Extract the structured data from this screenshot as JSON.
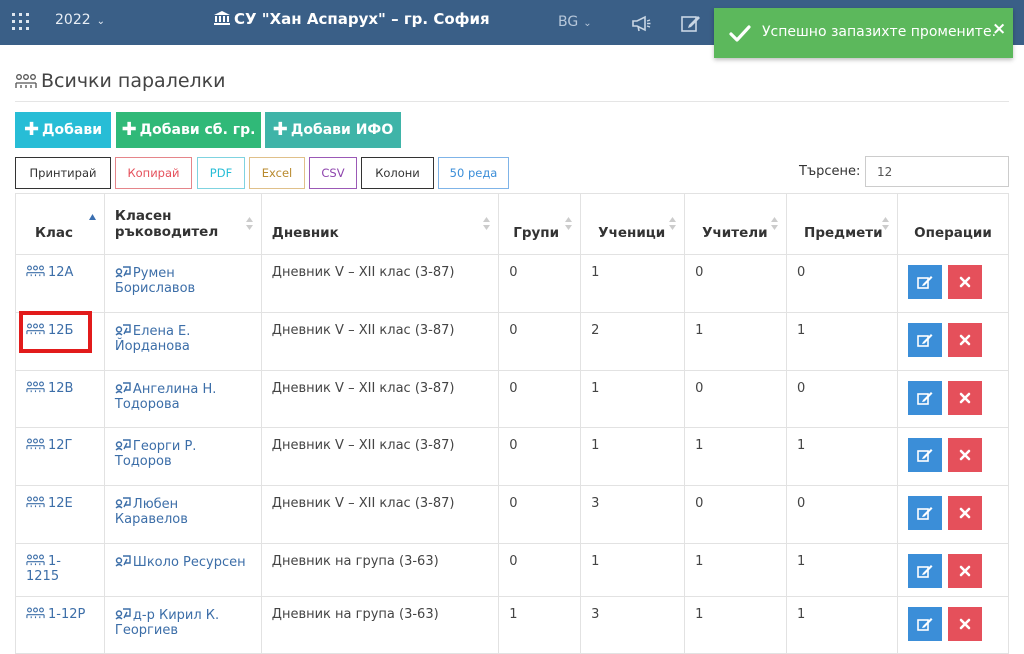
{
  "topbar": {
    "year": "2022",
    "school": "СУ \"Хан Аспарух\" – гр. София",
    "lang": "BG"
  },
  "toast": {
    "message": "Успешно запазихте промените.",
    "close": "×"
  },
  "page": {
    "title": "Всички паралелки"
  },
  "actions": {
    "add": "Добави",
    "add_group": "Добави сб. гр.",
    "add_ifo": "Добави ИФО"
  },
  "export": {
    "print": "Принтирай",
    "copy": "Копирай",
    "pdf": "PDF",
    "excel": "Excel",
    "csv": "CSV",
    "columns": "Колони",
    "rows": "50 реда"
  },
  "search": {
    "label": "Търсене:",
    "value": "12"
  },
  "table": {
    "headers": {
      "klas": "Клас",
      "teacher_line1": "Класен",
      "teacher_line2": "ръководител",
      "diary": "Дневник",
      "groups": "Групи",
      "students": "Ученици",
      "teachers": "Учители",
      "subjects": "Предмети",
      "ops": "Операции"
    },
    "rows": [
      {
        "klas": "12А",
        "t1": "Румен",
        "t2": "Бориславов",
        "diary": "Дневник V – XII клас (3-87)",
        "groups": "0",
        "students": "1",
        "teachers": "0",
        "subjects": "0"
      },
      {
        "klas": "12Б",
        "t1": "Елена Е.",
        "t2": "Йорданова",
        "diary": "Дневник V – XII клас (3-87)",
        "groups": "0",
        "students": "2",
        "teachers": "1",
        "subjects": "1"
      },
      {
        "klas": "12В",
        "t1": "Ангелина Н.",
        "t2": "Тодорова",
        "diary": "Дневник V – XII клас (3-87)",
        "groups": "0",
        "students": "1",
        "teachers": "0",
        "subjects": "0"
      },
      {
        "klas": "12Г",
        "t1": "Георги Р.",
        "t2": "Тодоров",
        "diary": "Дневник V – XII клас (3-87)",
        "groups": "0",
        "students": "1",
        "teachers": "1",
        "subjects": "1"
      },
      {
        "klas": "12Е",
        "t1": "Любен",
        "t2": "Каравелов",
        "diary": "Дневник V – XII клас (3-87)",
        "groups": "0",
        "students": "3",
        "teachers": "0",
        "subjects": "0"
      },
      {
        "klas": "1-1215",
        "t1": "Школо Ресурсен",
        "t2": "",
        "diary": "Дневник на група (3-63)",
        "groups": "0",
        "students": "1",
        "teachers": "1",
        "subjects": "1"
      },
      {
        "klas": "1-12Р",
        "t1": "д-р Кирил К.",
        "t2": "Георгиев",
        "diary": "Дневник на група (3-63)",
        "groups": "1",
        "students": "3",
        "teachers": "1",
        "subjects": "1"
      }
    ]
  },
  "colors": {
    "topbar": "#3a5f87",
    "toast": "#5cb85c",
    "btn_add": "#27bdd6",
    "btn_add_group": "#30b978",
    "btn_add_ifo": "#3fb4a8",
    "edit": "#3b8ed8",
    "delete": "#e5505b",
    "highlight": "#e21b1b"
  }
}
